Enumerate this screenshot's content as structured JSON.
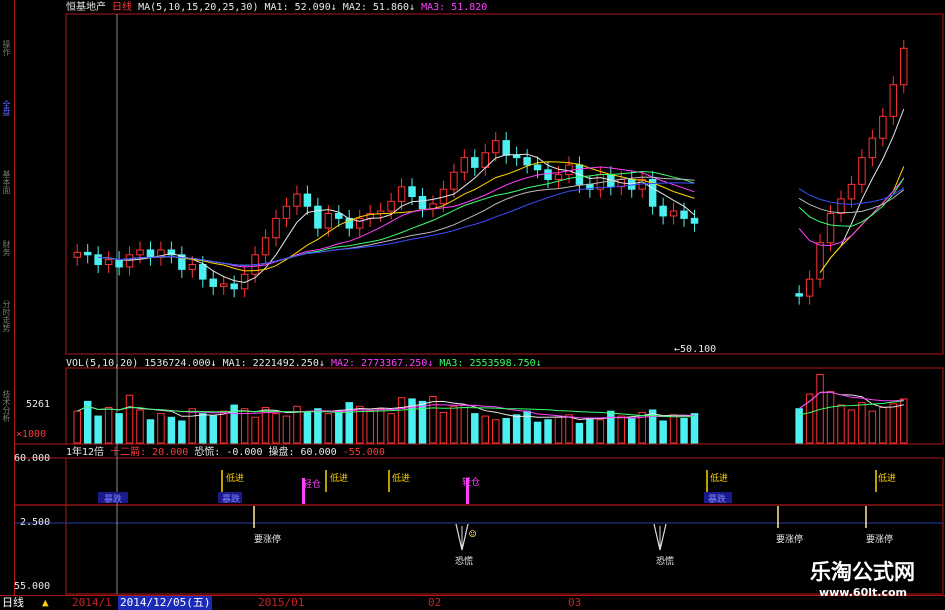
{
  "header": {
    "stock_name": "恒基地产",
    "period": "日线",
    "ma_label": "MA(5,10,15,20,25,30)",
    "ma1": "MA1: 52.090↓",
    "ma2": "MA2: 51.860↓",
    "ma3": "MA3: 51.820"
  },
  "price_panel": {
    "low_marker": "50.100"
  },
  "volume_panel": {
    "label": "VOL(5,10,20)",
    "vol": "1536724.000↓",
    "ma1": "MA1: 2221492.250↓",
    "ma2": "MA2: 2773367.250↓",
    "ma3": "MA3: 2553598.750↓",
    "axis_top": "5261",
    "axis_bottom": "×1000"
  },
  "indicator_panel": {
    "name": "1年12倍",
    "sub": "十二箭: 20.000",
    "fear": "恐慌: -0.000",
    "operator": "操盘: 60.000",
    "operator2": "-55.000",
    "axis": [
      "60.000",
      "2.500",
      "55.000"
    ],
    "labels": {
      "low_entry": "低进",
      "light_position": "轻仓",
      "about_limit_up": "要涨停",
      "panic": "恐慌",
      "plunge": "暴跌"
    }
  },
  "sidebar": {
    "items": [
      "操作",
      "全盘",
      "基本面",
      "财务",
      "分时走势",
      "技术分析"
    ]
  },
  "bottom_bar": {
    "period_tab": "日线",
    "dates": [
      "2014/1",
      "2014/12/05(五)",
      "2015/01",
      "02",
      "03"
    ]
  },
  "watermark": {
    "title": "乐淘公式网",
    "url": "www.60lt.com"
  },
  "colors": {
    "up": "#ff3333",
    "down": "#4df0f0",
    "ma_white": "#e8e8e8",
    "ma_yellow": "#ffd400",
    "ma_magenta": "#ff40ff",
    "ma_green": "#3cff6a",
    "ma_blue": "#3b4cff",
    "border": "#b01818"
  },
  "chart_data": {
    "type": "candlestick",
    "title": "恒基地产",
    "price": {
      "open": [
        53.4,
        53.6,
        53.5,
        53.1,
        53.3,
        53.0,
        53.5,
        53.7,
        53.4,
        53.7,
        53.5,
        52.9,
        53.1,
        52.5,
        52.2,
        52.3,
        52.1,
        52.7,
        53.5,
        54.2,
        55.0,
        55.5,
        56.0,
        55.5,
        54.6,
        55.2,
        55.0,
        54.6,
        55.0,
        55.2,
        55.3,
        55.7,
        56.3,
        55.9,
        55.4,
        55.6,
        56.2,
        56.9,
        57.5,
        57.1,
        57.7,
        58.2,
        57.6,
        57.5,
        57.2,
        57.0,
        56.6,
        56.8,
        57.2,
        56.4,
        56.2,
        56.8,
        56.3,
        56.6,
        56.2,
        56.6,
        55.5,
        55.1,
        55.3,
        55.0,
        null,
        null,
        null,
        null,
        null,
        null,
        null,
        null,
        null,
        51.9,
        51.8,
        52.5,
        54.0,
        55.2,
        55.8,
        56.4,
        57.5,
        58.3,
        59.2,
        60.5
      ],
      "close": [
        53.6,
        53.5,
        53.1,
        53.3,
        53.0,
        53.5,
        53.7,
        53.4,
        53.7,
        53.5,
        52.9,
        53.1,
        52.5,
        52.2,
        52.3,
        52.1,
        52.7,
        53.5,
        54.2,
        55.0,
        55.5,
        56.0,
        55.5,
        54.6,
        55.2,
        55.0,
        54.6,
        55.0,
        55.2,
        55.3,
        55.7,
        56.3,
        55.9,
        55.4,
        55.6,
        56.2,
        56.9,
        57.5,
        57.1,
        57.7,
        58.2,
        57.6,
        57.5,
        57.2,
        57.0,
        56.6,
        56.8,
        57.2,
        56.4,
        56.2,
        56.8,
        56.3,
        56.6,
        56.2,
        56.6,
        55.5,
        55.1,
        55.3,
        55.0,
        54.8,
        null,
        null,
        null,
        null,
        null,
        null,
        null,
        null,
        null,
        51.8,
        52.5,
        54.0,
        55.2,
        55.8,
        56.4,
        57.5,
        58.3,
        59.2,
        60.5,
        62.0
      ],
      "ylim": [
        49.5,
        63.0
      ]
    },
    "volume": {
      "values": [
        2.6,
        3.4,
        2.2,
        2.9,
        2.4,
        3.9,
        2.7,
        1.9,
        2.4,
        2.1,
        1.8,
        2.8,
        2.4,
        2.2,
        2.6,
        3.1,
        2.8,
        2.1,
        2.9,
        2.4,
        2.2,
        3.0,
        2.5,
        2.8,
        2.4,
        2.6,
        3.3,
        3.0,
        2.6,
        2.8,
        2.4,
        3.7,
        3.6,
        3.4,
        3.8,
        2.5,
        3.0,
        3.1,
        2.4,
        2.2,
        1.9,
        2.0,
        2.3,
        2.6,
        1.7,
        1.9,
        2.1,
        2.3,
        1.6,
        2.0,
        1.9,
        2.6,
        2.2,
        2.0,
        2.5,
        2.7,
        1.8,
        2.3,
        2.0,
        2.4,
        null,
        null,
        null,
        null,
        null,
        null,
        null,
        null,
        null,
        2.8,
        4.0,
        5.6,
        4.2,
        3.1,
        2.7,
        3.3,
        2.6,
        2.9,
        3.2,
        3.6
      ],
      "unit": "×1000"
    },
    "indicator": {
      "ylim": [
        -55,
        60
      ]
    }
  }
}
